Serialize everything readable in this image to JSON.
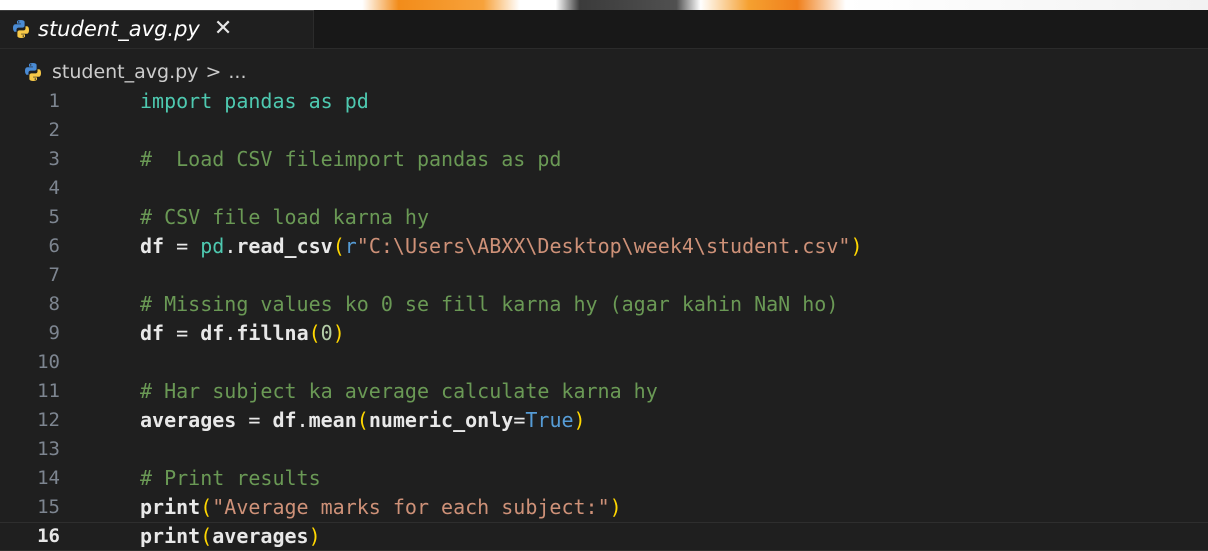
{
  "tab": {
    "title": "student_avg.py",
    "close_glyph": "✕",
    "icon": "python-icon"
  },
  "breadcrumb": {
    "file": "student_avg.py",
    "sep": ">",
    "more": "..."
  },
  "lines": [
    {
      "n": "1",
      "tokens": [
        [
          "kw",
          "import"
        ],
        [
          "op",
          " "
        ],
        [
          "mod",
          "pandas"
        ],
        [
          "op",
          " "
        ],
        [
          "kw",
          "as"
        ],
        [
          "op",
          " "
        ],
        [
          "mod",
          "pd"
        ]
      ]
    },
    {
      "n": "2",
      "tokens": []
    },
    {
      "n": "3",
      "tokens": [
        [
          "cm",
          "#  Load CSV fileimport pandas as pd"
        ]
      ]
    },
    {
      "n": "4",
      "tokens": []
    },
    {
      "n": "5",
      "tokens": [
        [
          "cm",
          "# CSV file load karna hy"
        ]
      ]
    },
    {
      "n": "6",
      "tokens": [
        [
          "var",
          "df"
        ],
        [
          "op",
          " = "
        ],
        [
          "mod",
          "pd"
        ],
        [
          "op",
          "."
        ],
        [
          "fn",
          "read_csv"
        ],
        [
          "br1",
          "("
        ],
        [
          "bool",
          "r"
        ],
        [
          "str",
          "\"C:\\Users\\ABXX\\Desktop\\week4\\student.csv\""
        ],
        [
          "br1",
          ")"
        ]
      ]
    },
    {
      "n": "7",
      "tokens": []
    },
    {
      "n": "8",
      "tokens": [
        [
          "cm",
          "# Missing values ko 0 se fill karna hy (agar kahin NaN ho)"
        ]
      ]
    },
    {
      "n": "9",
      "tokens": [
        [
          "var",
          "df"
        ],
        [
          "op",
          " = "
        ],
        [
          "var",
          "df"
        ],
        [
          "op",
          "."
        ],
        [
          "fn",
          "fillna"
        ],
        [
          "br1",
          "("
        ],
        [
          "num",
          "0"
        ],
        [
          "br1",
          ")"
        ]
      ]
    },
    {
      "n": "10",
      "tokens": []
    },
    {
      "n": "11",
      "tokens": [
        [
          "cm",
          "# Har subject ka average calculate karna hy"
        ]
      ]
    },
    {
      "n": "12",
      "tokens": [
        [
          "var",
          "averages"
        ],
        [
          "op",
          " = "
        ],
        [
          "var",
          "df"
        ],
        [
          "op",
          "."
        ],
        [
          "fn",
          "mean"
        ],
        [
          "br1",
          "("
        ],
        [
          "var",
          "numeric_only"
        ],
        [
          "op",
          "="
        ],
        [
          "bool",
          "True"
        ],
        [
          "br1",
          ")"
        ]
      ]
    },
    {
      "n": "13",
      "tokens": []
    },
    {
      "n": "14",
      "tokens": [
        [
          "cm",
          "# Print results"
        ]
      ]
    },
    {
      "n": "15",
      "tokens": [
        [
          "fn",
          "print"
        ],
        [
          "br1",
          "("
        ],
        [
          "str",
          "\"Average marks for each subject:\""
        ],
        [
          "br1",
          ")"
        ]
      ]
    },
    {
      "n": "16",
      "tokens": [
        [
          "fn",
          "print"
        ],
        [
          "br1",
          "("
        ],
        [
          "var",
          "averages"
        ],
        [
          "br1",
          ")"
        ]
      ]
    }
  ],
  "active_line": "16",
  "colors": {
    "editor_bg": "#1f1f1f",
    "comment": "#6a9955",
    "keyword": "#4ec9b0",
    "string": "#ce9178",
    "bracket": "#ffd700",
    "bool": "#569cd6"
  }
}
